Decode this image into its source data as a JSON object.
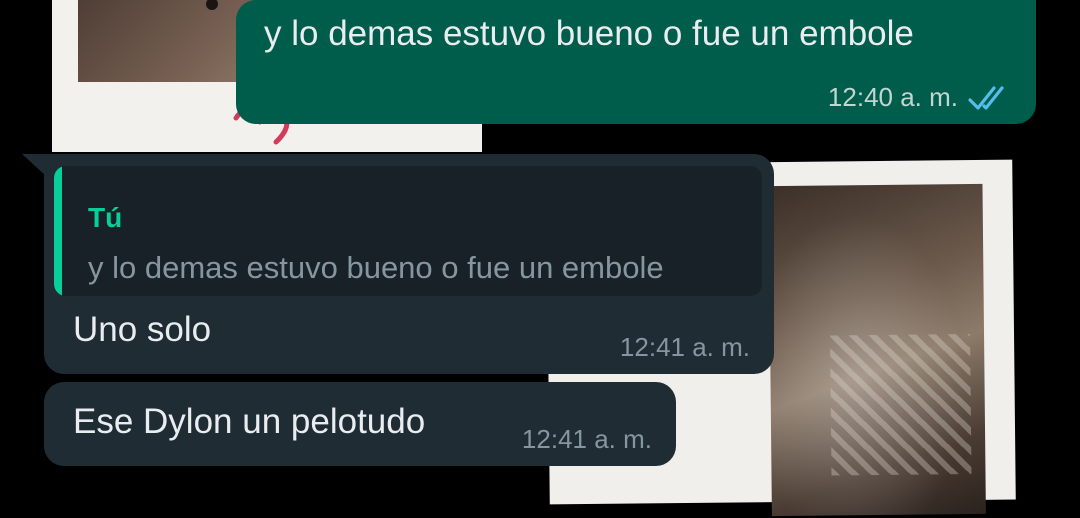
{
  "colors": {
    "outgoing_bubble": "#005c4b",
    "incoming_bubble": "#1f2c34",
    "quote_background": "#172127",
    "quote_accent": "#06cf9c",
    "read_ticks": "#53bdeb",
    "primary_text": "#e9edef",
    "secondary_text": "#8696a0"
  },
  "messages": [
    {
      "direction": "outgoing",
      "text": "y lo demas estuvo bueno o fue un embole",
      "time": "12:40 a. m.",
      "status_icon": "double-check-read-icon"
    },
    {
      "direction": "incoming",
      "reply_to": {
        "author": "Tú",
        "text": "y lo demas estuvo bueno o fue un embole"
      },
      "text": "Uno solo",
      "time": "12:41 a. m."
    },
    {
      "direction": "incoming",
      "text": "Ese Dylon un pelotudo",
      "time": "12:41 a. m."
    }
  ]
}
